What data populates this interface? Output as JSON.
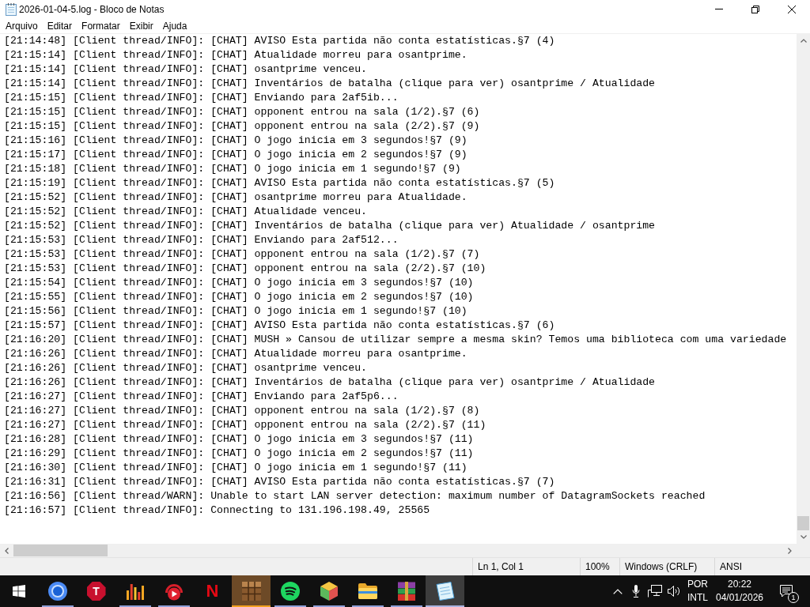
{
  "window": {
    "title": "2026-01-04-5.log - Bloco de Notas"
  },
  "menu": [
    "Arquivo",
    "Editar",
    "Formatar",
    "Exibir",
    "Ajuda"
  ],
  "document": {
    "lines": [
      "[21:14:48] [Client thread/INFO]: [CHAT] AVISO Esta partida não conta estatísticas.§7 (4)",
      "[21:15:14] [Client thread/INFO]: [CHAT] Atualidade morreu para osantprime.",
      "[21:15:14] [Client thread/INFO]: [CHAT] osantprime venceu.",
      "[21:15:14] [Client thread/INFO]: [CHAT] Inventários de batalha (clique para ver) osantprime / Atualidade",
      "[21:15:15] [Client thread/INFO]: [CHAT] Enviando para 2af5ib...",
      "[21:15:15] [Client thread/INFO]: [CHAT] opponent entrou na sala (1/2).§7 (6)",
      "[21:15:15] [Client thread/INFO]: [CHAT] opponent entrou na sala (2/2).§7 (9)",
      "[21:15:16] [Client thread/INFO]: [CHAT] O jogo inicia em 3 segundos!§7 (9)",
      "[21:15:17] [Client thread/INFO]: [CHAT] O jogo inicia em 2 segundos!§7 (9)",
      "[21:15:18] [Client thread/INFO]: [CHAT] O jogo inicia em 1 segundo!§7 (9)",
      "[21:15:19] [Client thread/INFO]: [CHAT] AVISO Esta partida não conta estatísticas.§7 (5)",
      "[21:15:52] [Client thread/INFO]: [CHAT] osantprime morreu para Atualidade.",
      "[21:15:52] [Client thread/INFO]: [CHAT] Atualidade venceu.",
      "[21:15:52] [Client thread/INFO]: [CHAT] Inventários de batalha (clique para ver) Atualidade / osantprime",
      "[21:15:53] [Client thread/INFO]: [CHAT] Enviando para 2af512...",
      "[21:15:53] [Client thread/INFO]: [CHAT] opponent entrou na sala (1/2).§7 (7)",
      "[21:15:53] [Client thread/INFO]: [CHAT] opponent entrou na sala (2/2).§7 (10)",
      "[21:15:54] [Client thread/INFO]: [CHAT] O jogo inicia em 3 segundos!§7 (10)",
      "[21:15:55] [Client thread/INFO]: [CHAT] O jogo inicia em 2 segundos!§7 (10)",
      "[21:15:56] [Client thread/INFO]: [CHAT] O jogo inicia em 1 segundo!§7 (10)",
      "[21:15:57] [Client thread/INFO]: [CHAT] AVISO Esta partida não conta estatísticas.§7 (6)",
      "[21:16:20] [Client thread/INFO]: [CHAT] MUSH » Cansou de utilizar sempre a mesma skin? Temos uma biblioteca com uma variedade",
      "[21:16:26] [Client thread/INFO]: [CHAT] Atualidade morreu para osantprime.",
      "[21:16:26] [Client thread/INFO]: [CHAT] osantprime venceu.",
      "[21:16:26] [Client thread/INFO]: [CHAT] Inventários de batalha (clique para ver) osantprime / Atualidade",
      "[21:16:27] [Client thread/INFO]: [CHAT] Enviando para 2af5p6...",
      "[21:16:27] [Client thread/INFO]: [CHAT] opponent entrou na sala (1/2).§7 (8)",
      "[21:16:27] [Client thread/INFO]: [CHAT] opponent entrou na sala (2/2).§7 (11)",
      "[21:16:28] [Client thread/INFO]: [CHAT] O jogo inicia em 3 segundos!§7 (11)",
      "[21:16:29] [Client thread/INFO]: [CHAT] O jogo inicia em 2 segundos!§7 (11)",
      "[21:16:30] [Client thread/INFO]: [CHAT] O jogo inicia em 1 segundo!§7 (11)",
      "[21:16:31] [Client thread/INFO]: [CHAT] AVISO Esta partida não conta estatísticas.§7 (7)",
      "[21:16:56] [Client thread/WARN]: Unable to start LAN server detection: maximum number of DatagramSockets reached",
      "[21:16:57] [Client thread/INFO]: Connecting to 131.196.198.49, 25565"
    ]
  },
  "status_bar": {
    "cursor_position": "Ln 1, Col 1",
    "zoom": "100%",
    "line_ending": "Windows (CRLF)",
    "encoding": "ANSI"
  },
  "taskbar": {
    "apps": [
      {
        "kind": "browser",
        "running": true,
        "selected": false,
        "attention": false
      },
      {
        "kind": "octagon",
        "glyph": "T",
        "running": false,
        "selected": false,
        "attention": false
      },
      {
        "kind": "barchart",
        "running": true,
        "selected": false,
        "attention": false
      },
      {
        "kind": "headset",
        "running": true,
        "selected": false,
        "attention": false
      },
      {
        "kind": "letter",
        "glyph": "N",
        "running": false,
        "selected": false,
        "attention": false
      },
      {
        "kind": "block",
        "running": true,
        "selected": false,
        "attention": true
      },
      {
        "kind": "waves",
        "running": true,
        "selected": false,
        "attention": false
      },
      {
        "kind": "cube",
        "running": true,
        "selected": false,
        "attention": false
      },
      {
        "kind": "folder",
        "running": true,
        "selected": false,
        "attention": false
      },
      {
        "kind": "books",
        "running": true,
        "selected": false,
        "attention": false
      },
      {
        "kind": "notepad",
        "running": true,
        "selected": true,
        "attention": false
      }
    ],
    "tray": {
      "language": "POR",
      "keyboard_layout": "INTL",
      "time": "20:22",
      "date": "04/01/2026",
      "notification_count": "1"
    }
  }
}
